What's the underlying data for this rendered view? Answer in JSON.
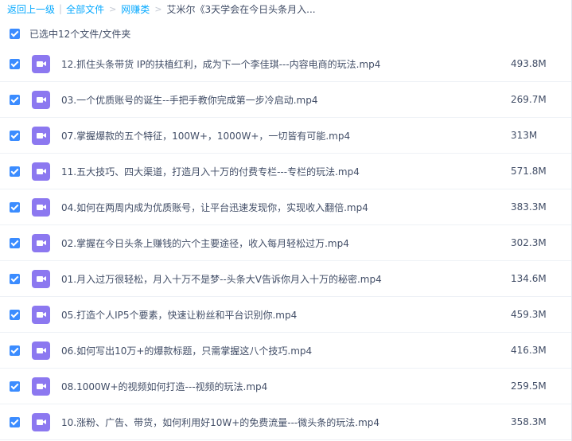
{
  "breadcrumb": {
    "back": "返回上一级",
    "all_files": "全部文件",
    "folder": "网赚类",
    "current": "艾米尔《3天学会在今日头条月入..."
  },
  "selection": {
    "text": "已选中12个文件/文件夹"
  },
  "icons": {
    "checkbox": "checkbox-checked-icon",
    "file": "video-file-icon"
  },
  "colors": {
    "link": "#09aaff",
    "checkbox": "#3b8cff",
    "file_icon": "#8c78f0"
  },
  "files": [
    {
      "name": "12.抓住头条带货 IP的扶植红利，成为下一个李佳琪---内容电商的玩法.mp4",
      "size": "493.8M"
    },
    {
      "name": "03.一个优质账号的诞生--手把手教你完成第一步冷启动.mp4",
      "size": "269.7M"
    },
    {
      "name": "07.掌握爆款的五个特征，100W+，1000W+，一切皆有可能.mp4",
      "size": "313M"
    },
    {
      "name": "11.五大技巧、四大渠道，打造月入十万的付费专栏---专栏的玩法.mp4",
      "size": "571.8M"
    },
    {
      "name": "04.如何在两周内成为优质账号，让平台迅速发现你，实现收入翻倍.mp4",
      "size": "383.3M"
    },
    {
      "name": "02.掌握在今日头条上赚钱的六个主要途径，收入每月轻松过万.mp4",
      "size": "302.3M"
    },
    {
      "name": "01.月入过万很轻松，月入十万不是梦--头条大V告诉你月入十万的秘密.mp4",
      "size": "134.6M"
    },
    {
      "name": "05.打造个人IP5个要素，快速让粉丝和平台识别你.mp4",
      "size": "459.3M"
    },
    {
      "name": "06.如何写出10万+的爆款标题，只需掌握这八个技巧.mp4",
      "size": "416.3M"
    },
    {
      "name": "08.1000W+的视频如何打造---视频的玩法.mp4",
      "size": "259.5M"
    },
    {
      "name": "10.涨粉、广告、带货，如何利用好10W+的免费流量---微头条的玩法.mp4",
      "size": "358.3M"
    }
  ]
}
